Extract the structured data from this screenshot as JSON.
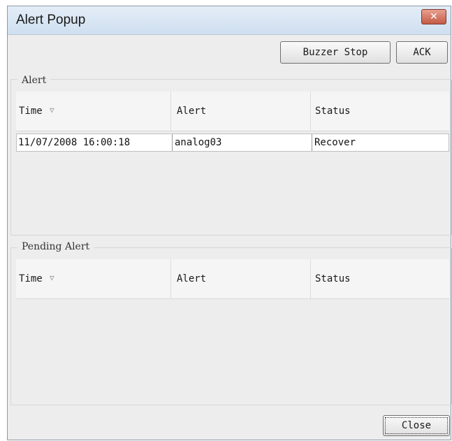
{
  "window": {
    "title": "Alert Popup",
    "close_glyph": "✕"
  },
  "toolbar": {
    "buzzer_stop_label": "Buzzer Stop",
    "ack_label": "ACK"
  },
  "alert_group": {
    "label": "Alert",
    "columns": [
      "Time",
      "Alert",
      "Status"
    ],
    "sort_indicator": "▽",
    "rows": [
      {
        "time": "11/07/2008 16:00:18",
        "alert": "analog03",
        "status": "Recover"
      }
    ]
  },
  "pending_group": {
    "label": "Pending Alert",
    "columns": [
      "Time",
      "Alert",
      "Status"
    ],
    "sort_indicator": "▽",
    "rows": []
  },
  "footer": {
    "close_label": "Close"
  }
}
